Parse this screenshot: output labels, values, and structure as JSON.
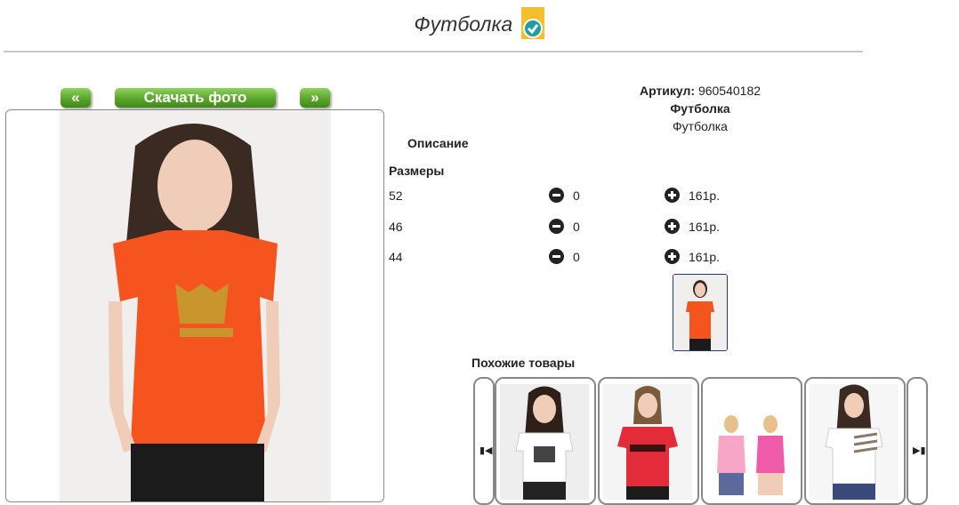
{
  "page": {
    "title": "Футболка"
  },
  "nav": {
    "prev_label": "«",
    "download_label": "Скачать фото",
    "next_label": "»"
  },
  "product": {
    "article_label": "Артикул:",
    "article_value": "960540182",
    "name": "Футболка",
    "subname": "Футболка",
    "description_heading": "Описание",
    "sizes_heading": "Размеры",
    "sizes": [
      {
        "size": "52",
        "qty": "0",
        "price": "161р."
      },
      {
        "size": "46",
        "qty": "0",
        "price": "161р."
      },
      {
        "size": "44",
        "qty": "0",
        "price": "161р."
      }
    ]
  },
  "similar": {
    "heading": "Похожие товары"
  },
  "colors": {
    "accent_green": "#5aa52b",
    "tshirt_orange": "#f5541f",
    "badge_yellow": "#f3c02b",
    "check_teal": "#1f9ea3"
  },
  "icons": [
    "verified-badge-icon",
    "minus-circle-icon",
    "plus-circle-icon",
    "first-page-icon",
    "last-page-icon"
  ]
}
